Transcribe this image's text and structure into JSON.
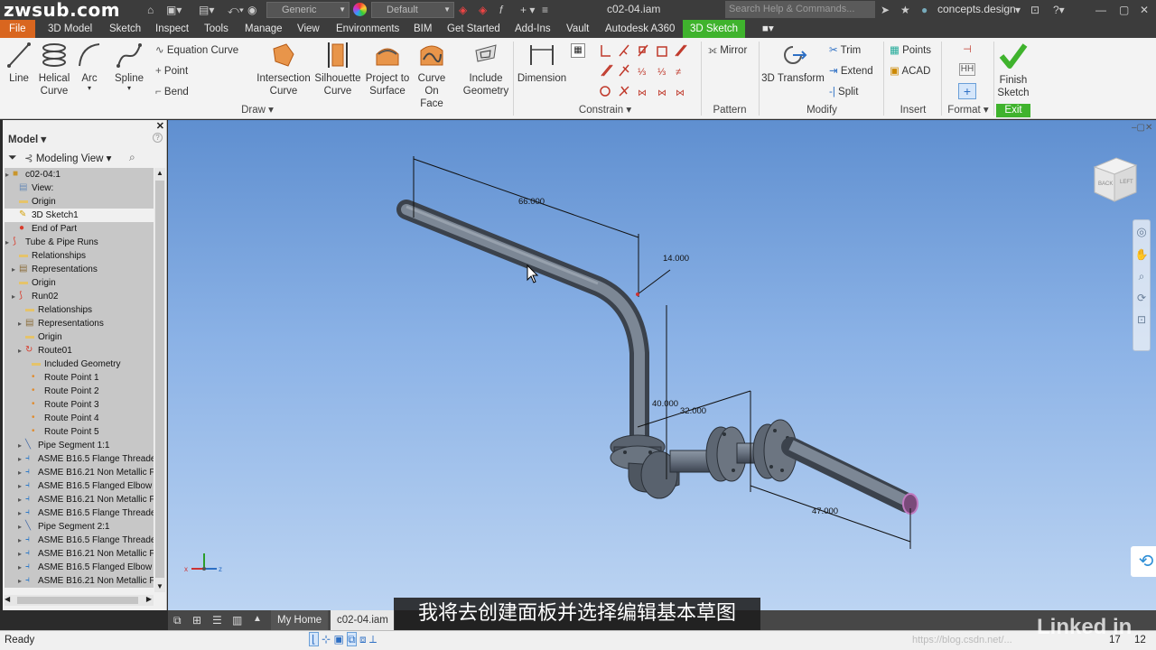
{
  "watermark": "zwsub.com",
  "titlebar": {
    "appearance": "Generic",
    "material": "Default",
    "filename": "c02-04.iam",
    "search_placeholder": "Search Help & Commands...",
    "user": "concepts.design"
  },
  "menu_tabs": [
    "File",
    "3D Model",
    "Sketch",
    "Inspect",
    "Tools",
    "Manage",
    "View",
    "Environments",
    "BIM",
    "Get Started",
    "Add-Ins",
    "Vault",
    "Autodesk A360",
    "3D Sketch"
  ],
  "active_tab": "3D Sketch",
  "ribbon": {
    "draw": {
      "line": "Line",
      "helical": [
        "Helical",
        "Curve"
      ],
      "arc": "Arc",
      "spline": "Spline",
      "equation_curve": "Equation Curve",
      "point": "Point",
      "bend": "Bend",
      "intersection": [
        "Intersection",
        "Curve"
      ],
      "silhouette": [
        "Silhouette",
        "Curve"
      ],
      "project": [
        "Project to",
        "Surface"
      ],
      "curve_on_face": [
        "Curve",
        "On Face"
      ],
      "include": [
        "Include",
        "Geometry"
      ],
      "title": "Draw"
    },
    "constrain": {
      "dimension": "Dimension",
      "title": "Constrain"
    },
    "pattern": {
      "mirror": "Mirror",
      "title": "Pattern"
    },
    "modify": {
      "transform": "3D Transform",
      "trim": "Trim",
      "extend": "Extend",
      "split": "Split",
      "title": "Modify"
    },
    "insert": {
      "points": "Points",
      "acad": "ACAD",
      "title": "Insert"
    },
    "format": {
      "title": "Format"
    },
    "exit": {
      "finish": [
        "Finish",
        "Sketch"
      ],
      "title": "Exit"
    }
  },
  "browser": {
    "title": "Model",
    "view_mode": "Modeling View",
    "tree": [
      {
        "label": "c02-04:1",
        "indent": 1,
        "icon": "assembly"
      },
      {
        "label": "View:",
        "indent": 2,
        "icon": "view"
      },
      {
        "label": "Origin",
        "indent": 2,
        "icon": "folder"
      },
      {
        "label": "3D Sketch1",
        "indent": 2,
        "icon": "sketch",
        "selected": true
      },
      {
        "label": "End of Part",
        "indent": 2,
        "icon": "end"
      },
      {
        "label": "Tube & Pipe Runs",
        "indent": 1,
        "icon": "runs"
      },
      {
        "label": "Relationships",
        "indent": 2,
        "icon": "folder"
      },
      {
        "label": "Representations",
        "indent": 2,
        "icon": "rep"
      },
      {
        "label": "Origin",
        "indent": 2,
        "icon": "folder"
      },
      {
        "label": "Run02",
        "indent": 2,
        "icon": "runs"
      },
      {
        "label": "Relationships",
        "indent": 3,
        "icon": "folder"
      },
      {
        "label": "Representations",
        "indent": 3,
        "icon": "rep"
      },
      {
        "label": "Origin",
        "indent": 3,
        "icon": "folder"
      },
      {
        "label": "Route01",
        "indent": 3,
        "icon": "route"
      },
      {
        "label": "Included Geometry",
        "indent": 4,
        "icon": "folder"
      },
      {
        "label": "Route Point 1",
        "indent": 4,
        "icon": "dot"
      },
      {
        "label": "Route Point 2",
        "indent": 4,
        "icon": "dot"
      },
      {
        "label": "Route Point 3",
        "indent": 4,
        "icon": "dot"
      },
      {
        "label": "Route Point 4",
        "indent": 4,
        "icon": "dot"
      },
      {
        "label": "Route Point 5",
        "indent": 4,
        "icon": "dot"
      },
      {
        "label": "Pipe Segment 1:1",
        "indent": 3,
        "icon": "pipe"
      },
      {
        "label": "ASME B16.5 Flange Threade",
        "indent": 3,
        "icon": "fitting"
      },
      {
        "label": "ASME B16.21 Non Metallic F",
        "indent": 3,
        "icon": "fitting"
      },
      {
        "label": "ASME B16.5 Flanged Elbow",
        "indent": 3,
        "icon": "fitting"
      },
      {
        "label": "ASME B16.21 Non Metallic F",
        "indent": 3,
        "icon": "fitting"
      },
      {
        "label": "ASME B16.5 Flange Threade",
        "indent": 3,
        "icon": "fitting"
      },
      {
        "label": "Pipe Segment 2:1",
        "indent": 3,
        "icon": "pipe"
      },
      {
        "label": "ASME B16.5 Flange Threade",
        "indent": 3,
        "icon": "fitting"
      },
      {
        "label": "ASME B16.21 Non Metallic F",
        "indent": 3,
        "icon": "fitting"
      },
      {
        "label": "ASME B16.5 Flanged Elbow",
        "indent": 3,
        "icon": "fitting"
      },
      {
        "label": "ASME B16.21 Non Metallic F",
        "indent": 3,
        "icon": "fitting"
      }
    ]
  },
  "dimensions": {
    "d1": "66.000",
    "d2": "14.000",
    "d3": "40.000",
    "d4": "32.000",
    "d5": "47.000"
  },
  "viewcube": {
    "back": "BACK",
    "left": "LEFT"
  },
  "doc_tabs": {
    "home": "My Home",
    "doc": "c02-04.iam"
  },
  "subtitle": "我将去创建面板并选择编辑基本草图",
  "status": {
    "ready": "Ready",
    "n1": "17",
    "n2": "12"
  },
  "url_watermark": "https://blog.csdn.net/...",
  "brand": "Linked in"
}
